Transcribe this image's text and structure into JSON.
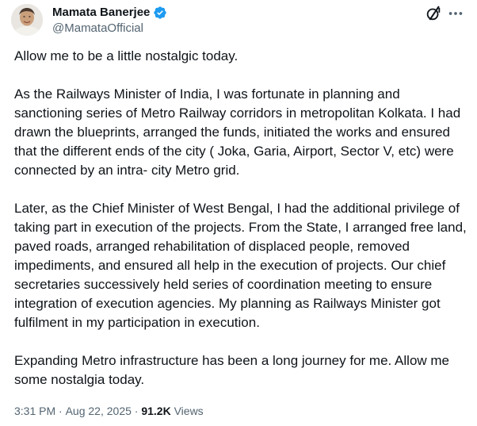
{
  "author": {
    "display_name": "Mamata Banerjee",
    "handle": "@MamataOfficial",
    "verified_icon": "verified-badge-icon",
    "avatar_icon": "profile-avatar"
  },
  "header_actions": {
    "grok_icon": "grok-icon",
    "more_icon": "more-options-icon"
  },
  "post": {
    "paragraphs": [
      "Allow me to be a little nostalgic today.",
      "As the  Railways Minister of India, I was fortunate in planning and sanctioning series of Metro Railway corridors in metropolitan Kolkata. I had drawn the blueprints, arranged the funds, initiated the works and ensured that the different ends of the city ( Joka, Garia, Airport, Sector V, etc) were connected by an intra- city Metro grid.",
      "Later, as the Chief Minister of West Bengal, I had the additional privilege of taking part in execution of the projects. From the State, I arranged free land,  paved roads, arranged rehabilitation of displaced people, removed impediments, and ensured all help in the execution of projects. Our chief secretaries successively held series of coordination meeting to ensure integration of execution agencies. My planning as Railways Minister got fulfilment in my participation in execution.",
      "Expanding Metro infrastructure has been a  long journey for me. Allow me some nostalgia today."
    ]
  },
  "meta": {
    "time": "3:31 PM",
    "separator": " · ",
    "date": "Aug 22, 2025",
    "separator2": " · ",
    "views_count": "91.2K",
    "views_label": " Views"
  },
  "colors": {
    "text": "#0f1419",
    "secondary": "#536471",
    "verified": "#1d9bf0"
  }
}
